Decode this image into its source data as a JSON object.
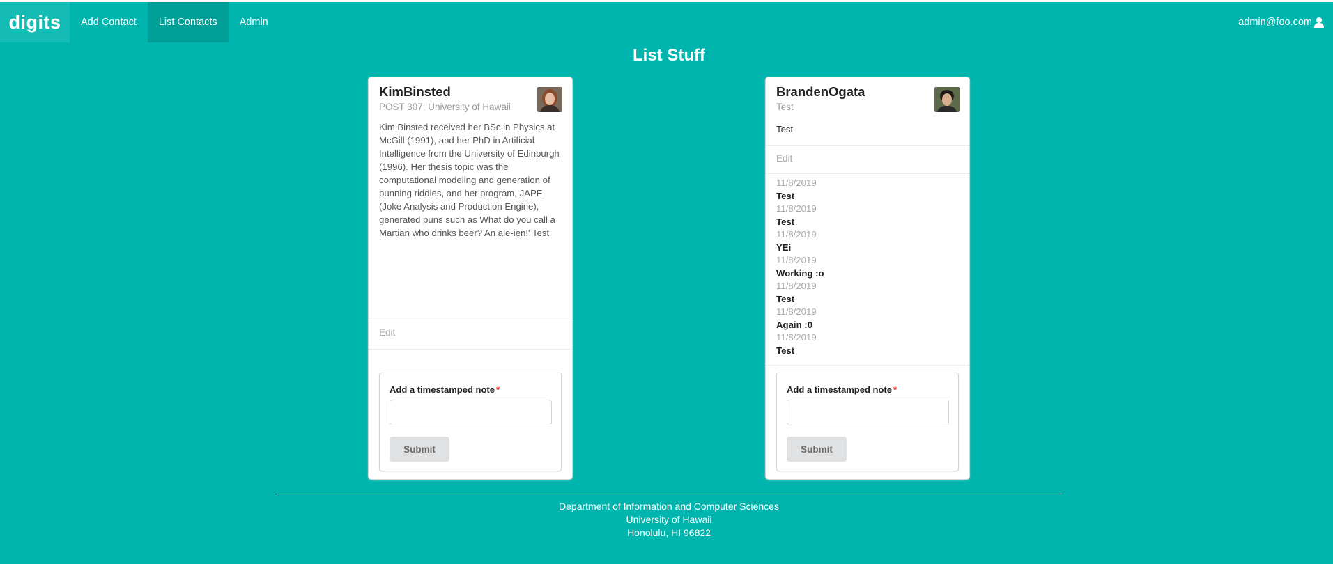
{
  "nav": {
    "brand": "digits",
    "items": [
      {
        "label": "Add Contact"
      },
      {
        "label": "List Contacts"
      },
      {
        "label": "Admin"
      }
    ],
    "user": "admin@foo.com",
    "user_icon": "user-icon"
  },
  "page": {
    "title": "List Stuff"
  },
  "contacts": [
    {
      "name": "KimBinsted",
      "address": "POST 307, University of Hawaii",
      "description": "Kim Binsted received her BSc in Physics at McGill (1991), and her PhD in Artificial Intelligence from the University of Edinburgh (1996). Her thesis topic was the computational modeling and generation of punning riddles, and her program, JAPE (Joke Analysis and Production Engine), generated puns such as What do you call a Martian who drinks beer? An ale-ien!' Test",
      "edit_label": "Edit",
      "notes": [],
      "form": {
        "label": "Add a timestamped note",
        "required_mark": "*",
        "submit": "Submit"
      }
    },
    {
      "name": "BrandenOgata",
      "address": "Test",
      "description": "Test",
      "edit_label": "Edit",
      "notes": [
        {
          "date": "11/8/2019",
          "text": "Test"
        },
        {
          "date": "11/8/2019",
          "text": "Test"
        },
        {
          "date": "11/8/2019",
          "text": "YEi"
        },
        {
          "date": "11/8/2019",
          "text": "Working :o"
        },
        {
          "date": "11/8/2019",
          "text": "Test"
        },
        {
          "date": "11/8/2019",
          "text": "Again :0"
        },
        {
          "date": "11/8/2019",
          "text": "Test"
        }
      ],
      "form": {
        "label": "Add a timestamped note",
        "required_mark": "*",
        "submit": "Submit"
      }
    }
  ],
  "footer": {
    "line1": "Department of Information and Computer Sciences",
    "line2": "University of Hawaii",
    "line3": "Honolulu, HI 96822"
  },
  "colors": {
    "background": "#00b5ad",
    "active_nav": "#009f97",
    "required": "#db2828"
  }
}
